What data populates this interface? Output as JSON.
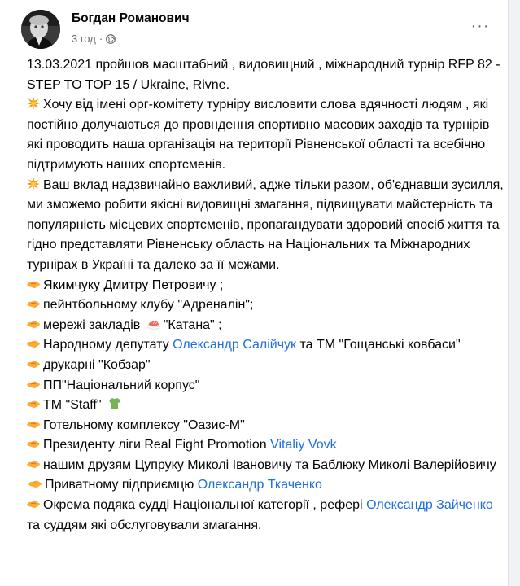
{
  "post": {
    "author": "Богдан Романович",
    "time": "3 год",
    "dot": "·",
    "privacy_icon": "globe-icon",
    "more_icon": "more-options-icon",
    "more_label": "···"
  },
  "content": {
    "intro": "13.03.2021  пройшов масштабний , видовищний , міжнародний турнір RFP 82 - STEP TO TOP 15 / Ukraine, Rivne.",
    "para1": "Хочу від імені орг-комітету турніру висловити слова вдячності людям , які постійно долучаються до провндення спортивно масових заходів та турнірів які проводить наша організація на території Рівненської області та всебічно підтримують наших спортсменів.",
    "para2": "Ваш вклад надзвичайно важливий, адже тільки разом, об'єднавши зусилля, ми зможемо робити якісні видовищні змагання, підвищувати майстерність та популярність місцевих спортсменів, пропагандувати здоровий спосіб життя та гідно представляти Рівненську область на Національних та Міжнародних турнірах в Україні та далеко за її межами.",
    "para_emoji": "collision-emoji",
    "thanks_emoji": "handshake-emoji",
    "t1": "Якимчуку Дмитру Петровичу ;",
    "t2": "пейнтбольному клубу \"Адреналін\";",
    "t3a": "мережі закладів",
    "t3b": "\"Катана\" ;",
    "t3_emoji": "sushi-emoji",
    "t4a": "Народному депутату",
    "t4_link": "Олександр Салійчук",
    "t4b": "та ТМ \"Гощанські ковбаси\"",
    "t5": "друкарні \"Кобзар\"",
    "t6": "ПП\"Національний корпус\"",
    "t7": "ТМ \"Staff\"",
    "t7_emoji": "shirt-emoji",
    "t8": "Готельному комплексу \"Оазис-М\"",
    "t9a": "Президенту ліги Real Fight Promotion",
    "t9_link": "Vitaliy Vovk",
    "t10a": "нашим друзям Цупруку Миколі Івановичу та Баблюку Миколі Валерійовичу",
    "t10b": "Приватному підприємцю",
    "t10_link": "Олександр Ткаченко",
    "t11a": "Окрема подяка судді Національної категорії , рефері",
    "t11_link": "Олександр Зайченко",
    "t11b": "та суддям які обслуговували змагання.",
    "link_color": "#216fdb"
  }
}
